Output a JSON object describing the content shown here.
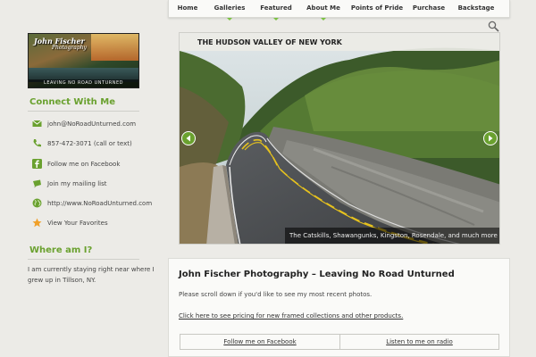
{
  "nav": {
    "items": [
      {
        "label": "Home"
      },
      {
        "label": "Galleries"
      },
      {
        "label": "Featured"
      },
      {
        "label": "About Me"
      },
      {
        "label": "Points of Pride"
      },
      {
        "label": "Purchase"
      },
      {
        "label": "Backstage"
      }
    ]
  },
  "logo": {
    "name": "John Fischer",
    "sub": "Photography",
    "tagline": "LEAVING NO ROAD UNTURNED"
  },
  "sidebar": {
    "connect_heading": "Connect With Me",
    "contacts": [
      {
        "icon": "email-icon",
        "label": "john@NoRoadUnturned.com"
      },
      {
        "icon": "phone-icon",
        "label": "857-472-3071 (call or text)"
      },
      {
        "icon": "facebook-icon",
        "label": "Follow me on Facebook"
      },
      {
        "icon": "mailing-list-icon",
        "label": "Join my mailing list"
      },
      {
        "icon": "globe-icon",
        "label": "http://www.NoRoadUnturned.com"
      },
      {
        "icon": "star-icon",
        "label": "View Your Favorites"
      }
    ],
    "where_heading": "Where am I?",
    "where_text": "I am currently staying right near where I grew up in Tillson, NY."
  },
  "slider": {
    "title": "THE HUDSON VALLEY OF NEW YORK",
    "caption": "The Catskills, Shawangunks, Kingston, Rosendale, and much more"
  },
  "content": {
    "title": "John Fischer Photography – Leaving No Road Unturned",
    "intro": "Please scroll down if you'd like to see my most recent photos.",
    "pricing_link": "Click here to see pricing for new framed collections and other products.",
    "links": [
      {
        "label": "Follow me on Facebook"
      },
      {
        "label": "Listen to me on radio"
      }
    ]
  },
  "colors": {
    "accent": "#6aa12f",
    "nav_caret": "#7ac142"
  }
}
